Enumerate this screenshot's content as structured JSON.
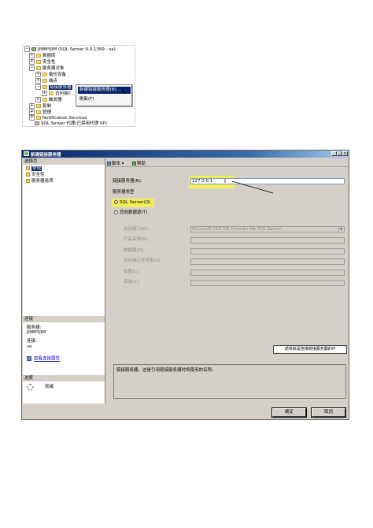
{
  "tree": {
    "items": [
      {
        "expander": "−",
        "label": "JIMMYJIM (SQL Server 9.0.1399 - sa)",
        "icon": "server"
      },
      {
        "expander": "+",
        "label": "数据库",
        "icon": "folder"
      },
      {
        "expander": "+",
        "label": "安全性",
        "icon": "folder"
      },
      {
        "expander": "−",
        "label": "服务器对象",
        "icon": "folder"
      },
      {
        "expander": "+",
        "label": "备份设备",
        "icon": "folder"
      },
      {
        "expander": "+",
        "label": "端点",
        "icon": "folder"
      },
      {
        "expander": "−",
        "label": "链接服务器",
        "icon": "folder"
      },
      {
        "expander": "+",
        "label": "访问接口",
        "icon": "folder"
      },
      {
        "expander": "+",
        "label": "触发器",
        "icon": "folder"
      },
      {
        "expander": "+",
        "label": "复制",
        "icon": "folder"
      },
      {
        "expander": "+",
        "label": "管理",
        "icon": "folder"
      },
      {
        "expander": "+",
        "label": "Notification Services",
        "icon": "folder"
      },
      {
        "expander": "",
        "label": "SQL Server 代理(已禁用代理 XP)",
        "icon": "agent"
      }
    ],
    "partial_label": "访问接C"
  },
  "context_menu": {
    "items": [
      "新建链接服务器(N)...",
      "刷新(F)"
    ]
  },
  "dialog": {
    "title": "新建链接服务器",
    "title_buttons": [
      "_",
      "□",
      "×"
    ],
    "select_page_header": "选择页",
    "pages": [
      "常规",
      "安全性",
      "服务器选项"
    ],
    "toolbar": {
      "script": "脚本",
      "script_arrow": "▾",
      "help": "帮助"
    },
    "linked_server_label": "链接服务器(N):",
    "linked_server_value": "127.0.0.1",
    "server_type_label": "服务器类型",
    "radio_sql": "SQL Server(Q)",
    "radio_other": "其他数据源(T)",
    "provider_label": "访问接口(P):",
    "provider_value": "Microsoft OLE DB Provider for SQL Server",
    "product_label": "产品名称(R):",
    "datasource_label": "数据源(D):",
    "provider_string_label": "访问接口字符串(S):",
    "location_label": "位置(L):",
    "catalog_label": "目录(C):",
    "callout": "通常就是连接链接服务器的IP",
    "description": "链接服务器，这是引用链接服务器时将使用的名称。",
    "connection_header": "连接",
    "server_caption": "服务器:",
    "server_value": "JIMMYJIM",
    "connection_caption": "连接:",
    "connection_value": "sa",
    "view_connection_link": "查看连接属性",
    "progress_header": "进度",
    "progress_status": "就绪",
    "ok_button": "确定",
    "cancel_button": "取消"
  },
  "colors": {
    "titlebar": "#0a246a",
    "highlight": "#f8f24a",
    "dialog_bg": "#d4d0c8"
  }
}
